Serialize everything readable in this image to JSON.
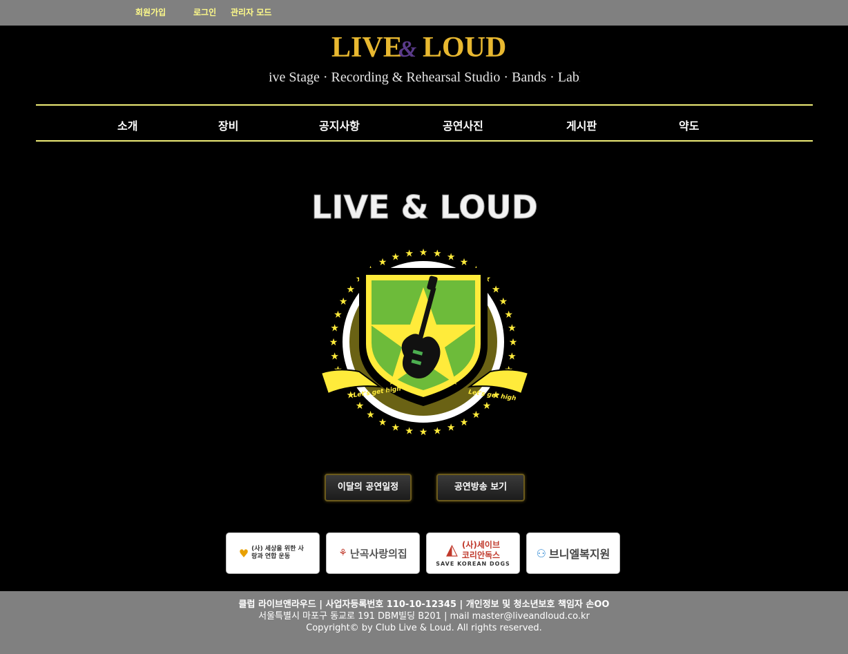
{
  "topbar": {
    "signup": "회원가입",
    "login": "로그인",
    "admin": "관리자 모드"
  },
  "header": {
    "logo_text_left": "LIVE",
    "logo_text_amp": "&",
    "logo_text_right": "LOUD",
    "tagline": "Live Stage · Recording & Rehearsal Studio · Bands · Lable"
  },
  "nav": {
    "items": [
      "소개",
      "장비",
      "공지사항",
      "공연사진",
      "게시판",
      "약도"
    ]
  },
  "emblem": {
    "title": "LIVE & LOUD",
    "ribbon_left": "Let's get high",
    "ribbon_right": "Let's get high"
  },
  "buttons": {
    "schedule": "이달의 공연일정",
    "broadcast": "공연방송 보기"
  },
  "partners": {
    "p1": "(사) 세상을 위한 사랑과 연합 운동",
    "p2": "난곡사랑의집",
    "p3_top": "(사)세이브",
    "p3_mid": "코리안독스",
    "p3_bottom": "SAVE KOREAN DOGS",
    "p4": "브니엘복지원"
  },
  "footer": {
    "line1": "클럽 라이브앤라우드 | 사업자등록번호 110-10-12345 | 개인정보 및 청소년보호 책임자 손OO",
    "line2": "서울특별시 마포구 동교로 191 DBM빌딩 B201 | mail master@liveandloud.co.kr",
    "line3": "Copyright© by Club Live & Loud. All rights reserved."
  },
  "colors": {
    "accent_yellow": "#f0ee77",
    "logo_gold": "#e8b830",
    "logo_purple": "#5a3a8a",
    "topbar_gray": "#808080"
  }
}
